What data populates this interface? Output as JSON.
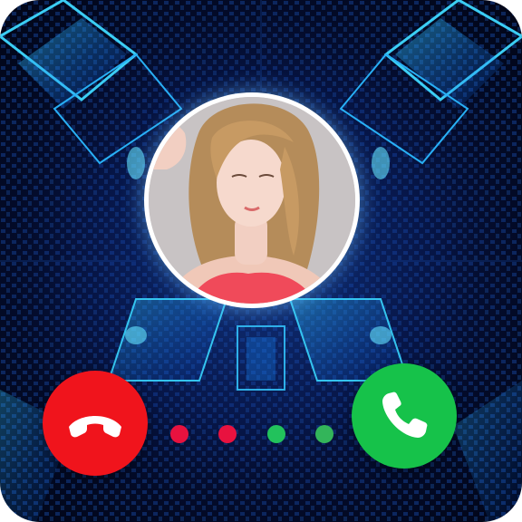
{
  "screen": {
    "type": "incoming-call"
  },
  "caller": {
    "avatar_icon": "caller-photo"
  },
  "actions": {
    "decline_icon": "phone-hangup-icon",
    "accept_icon": "phone-icon"
  },
  "indicator_dots": [
    {
      "color": "#e8123f"
    },
    {
      "color": "#e8123f"
    },
    {
      "color": "#22c25c"
    },
    {
      "color": "#33b55a"
    }
  ],
  "colors": {
    "decline": "#f0141c",
    "accept": "#16c24a",
    "background_glow": "#19c8ff"
  }
}
